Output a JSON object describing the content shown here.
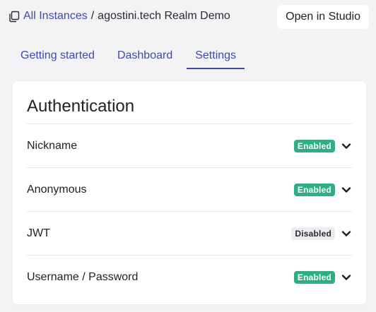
{
  "breadcrumb": {
    "icon": "copy-icon",
    "root_label": "All Instances",
    "separator": "/",
    "current": "agostini.tech Realm Demo"
  },
  "header": {
    "studio_button_label": "Open in Studio"
  },
  "tabs": [
    {
      "label": "Getting started",
      "active": false
    },
    {
      "label": "Dashboard",
      "active": false
    },
    {
      "label": "Settings",
      "active": true
    }
  ],
  "auth": {
    "title": "Authentication",
    "providers": [
      {
        "label": "Nickname",
        "status": "Enabled"
      },
      {
        "label": "Anonymous",
        "status": "Enabled"
      },
      {
        "label": "JWT",
        "status": "Disabled"
      },
      {
        "label": "Username / Password",
        "status": "Enabled"
      }
    ],
    "expand_icon": "chevron-down-icon"
  },
  "colors": {
    "accent": "#3f4aa8",
    "enabled_badge": "#2fae86",
    "disabled_badge": "#ececf0",
    "background": "#f3f3f6"
  }
}
